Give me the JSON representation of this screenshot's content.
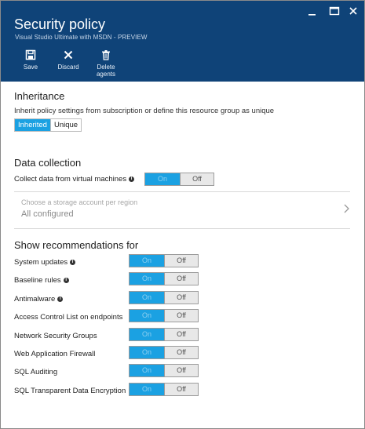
{
  "window": {
    "title": "Security policy",
    "subtitle": "Visual Studio Ultimate with MSDN - PREVIEW"
  },
  "toolbar": {
    "save_label": "Save",
    "discard_label": "Discard",
    "delete_label": "Delete agents"
  },
  "inheritance": {
    "heading": "Inheritance",
    "description": "Inherit policy settings from subscription or define this resource group as unique",
    "options": [
      "Inherited",
      "Unique"
    ],
    "selected": "Inherited"
  },
  "data_collection": {
    "heading": "Data collection",
    "collect_label": "Collect data from virtual machines",
    "toggle_on": "On",
    "toggle_off": "Off",
    "storage_placeholder": "Choose a storage account per region",
    "storage_value": "All configured"
  },
  "recommendations": {
    "heading": "Show recommendations for",
    "on_label": "On",
    "off_label": "Off",
    "items": [
      {
        "label": "System updates",
        "info": true,
        "state": "On"
      },
      {
        "label": "Baseline rules",
        "info": true,
        "state": "On"
      },
      {
        "label": "Antimalware",
        "info": true,
        "state": "On"
      },
      {
        "label": "Access Control List on endpoints",
        "info": false,
        "state": "On"
      },
      {
        "label": "Network Security Groups",
        "info": false,
        "state": "On"
      },
      {
        "label": "Web Application Firewall",
        "info": false,
        "state": "On"
      },
      {
        "label": "SQL Auditing",
        "info": false,
        "state": "On"
      },
      {
        "label": "SQL Transparent Data Encryption",
        "info": false,
        "state": "On"
      }
    ]
  },
  "colors": {
    "header_bg": "#0f4378",
    "accent": "#1ba1e2"
  }
}
